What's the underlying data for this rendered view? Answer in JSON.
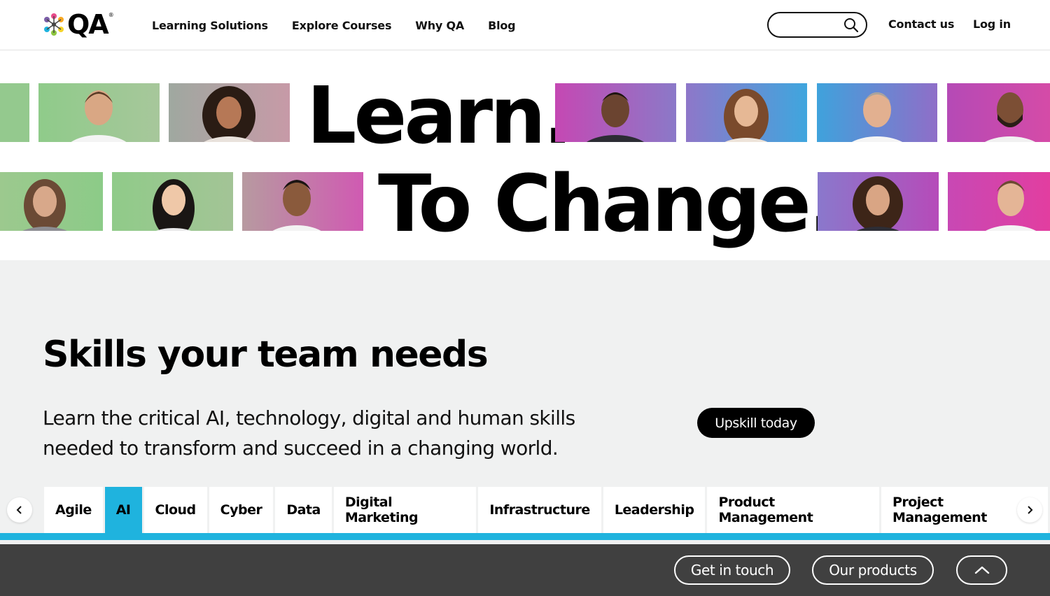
{
  "brand": {
    "name": "QA",
    "reg": "®",
    "accent": "#1fb3de",
    "footer_bg": "#404040"
  },
  "nav": {
    "items": [
      {
        "label": "Learning Solutions"
      },
      {
        "label": "Explore Courses"
      },
      {
        "label": "Why QA"
      },
      {
        "label": "Blog"
      }
    ]
  },
  "header": {
    "search_placeholder": "",
    "contact_label": "Contact us",
    "login_label": "Log in"
  },
  "hero": {
    "line1": "Learn.",
    "line2": "To Change."
  },
  "skills": {
    "title": "Skills your team needs",
    "description": "Learn the critical AI, technology, digital and human skills needed to transform and succeed in a changing world.",
    "cta_label": "Upskill today",
    "tabs": [
      {
        "label": "Agile",
        "active": false
      },
      {
        "label": "AI",
        "active": true
      },
      {
        "label": "Cloud",
        "active": false
      },
      {
        "label": "Cyber",
        "active": false
      },
      {
        "label": "Data",
        "active": false
      },
      {
        "label": "Digital Marketing",
        "active": false
      },
      {
        "label": "Infrastructure",
        "active": false
      },
      {
        "label": "Leadership",
        "active": false
      },
      {
        "label": "Product Management",
        "active": false
      },
      {
        "label": "Project Management",
        "active": false
      }
    ]
  },
  "footer_bar": {
    "get_in_touch_label": "Get in touch",
    "our_products_label": "Our products"
  }
}
